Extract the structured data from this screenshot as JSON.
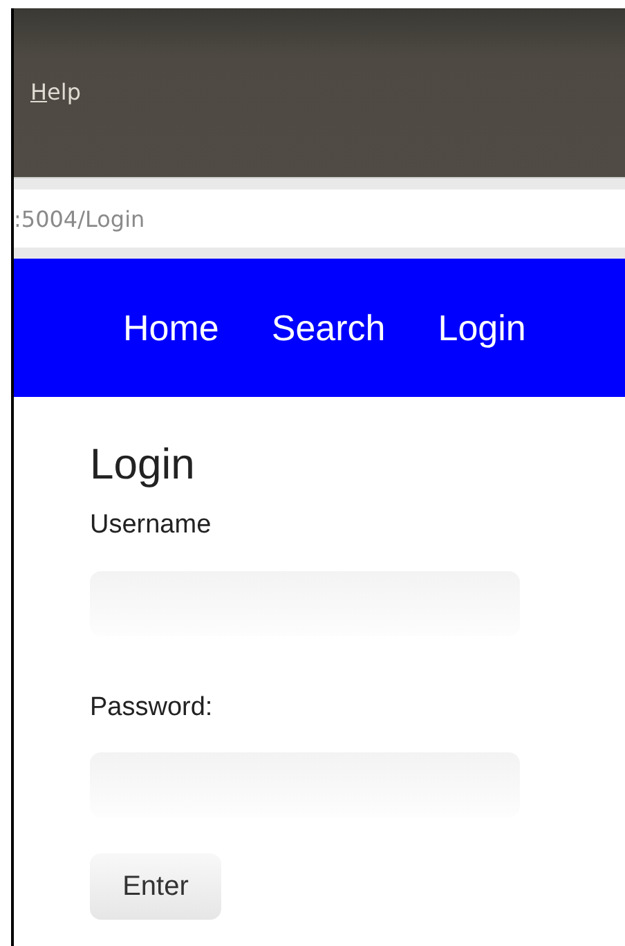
{
  "menu_bar": {
    "items": [
      {
        "label": "Help",
        "mnemonic": true
      }
    ]
  },
  "address_bar": {
    "value": ":5004/Login"
  },
  "navbar": {
    "links": [
      {
        "label": "Home"
      },
      {
        "label": "Search"
      },
      {
        "label": "Login"
      }
    ]
  },
  "form": {
    "title": "Login",
    "fields": [
      {
        "label": "Username"
      },
      {
        "label": "Password:"
      }
    ],
    "submit": "Enter"
  }
}
